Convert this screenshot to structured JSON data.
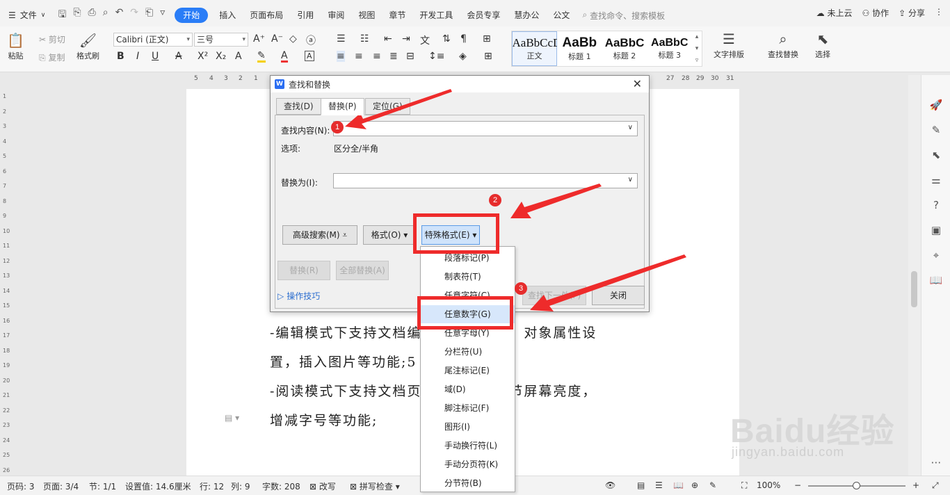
{
  "menubar": {
    "file_label": "文件",
    "tabs": [
      "开始",
      "插入",
      "页面布局",
      "引用",
      "审阅",
      "视图",
      "章节",
      "开发工具",
      "会员专享",
      "慧办公",
      "公文"
    ],
    "search_placeholder": "查找命令、搜索模板",
    "cloud": "未上云",
    "collab": "协作",
    "share": "分享"
  },
  "ribbon": {
    "paste": "粘贴",
    "cut": "剪切",
    "copy": "复制",
    "format_painter": "格式刷",
    "font_name": "Calibri (正文)",
    "font_size": "三号",
    "styles": [
      {
        "sample": "AaBbCcDd",
        "label": "正文"
      },
      {
        "sample": "AaBb",
        "label": "标题 1"
      },
      {
        "sample": "AaBbC",
        "label": "标题 2"
      },
      {
        "sample": "AaBbC",
        "label": "标题 3"
      }
    ],
    "text_layout": "文字排版",
    "find_replace": "查找替换",
    "select": "选择"
  },
  "ruler": {
    "left_ticks": [
      "5",
      "4",
      "3",
      "2",
      "1"
    ],
    "right_ticks": [
      "27",
      "28",
      "29",
      "30",
      "31"
    ],
    "v_ticks": [
      "1",
      "2",
      "3",
      "4",
      "5",
      "6",
      "7",
      "8",
      "9",
      "10",
      "11",
      "12",
      "13",
      "14",
      "15",
      "16",
      "17",
      "18",
      "19",
      "20",
      "21",
      "22",
      "23",
      "24",
      "25",
      "26"
    ]
  },
  "document": {
    "lines": [
      "-编辑模式下支持文档编　　　　　落、对象属性设",
      "置，插入图片等功能;5",
      "-阅读模式下支持文档页　　　　　调节屏幕亮度，",
      "增减字号等功能;"
    ]
  },
  "dialog": {
    "title": "查找和替换",
    "tabs": [
      "查找(D)",
      "替换(P)",
      "定位(G)"
    ],
    "find_label": "查找内容(N):",
    "options_label": "选项:",
    "options_value": "区分全/半角",
    "replace_label": "替换为(I):",
    "advanced_btn": "高级搜索(M)",
    "format_btn": "格式(O)",
    "special_btn": "特殊格式(E)",
    "replace_btn": "替换(R)",
    "replace_all_btn": "全部替换(A)",
    "find_next_btn": "查找下一处(F)",
    "close_btn": "关闭",
    "tips": "操作技巧"
  },
  "dropdown": {
    "items": [
      "段落标记(P)",
      "制表符(T)",
      "任意字符(C)",
      "任意数字(G)",
      "任意字母(Y)",
      "分栏符(U)",
      "尾注标记(E)",
      "域(D)",
      "脚注标记(F)",
      "图形(I)",
      "手动换行符(L)",
      "手动分页符(K)",
      "分节符(B)"
    ],
    "highlighted": "任意数字(G)"
  },
  "annotations": {
    "badges": [
      "1",
      "2",
      "3"
    ],
    "color": "#ee2b2b"
  },
  "status": {
    "page_num": "页码: 3",
    "pages": "页面: 3/4",
    "section": "节: 1/1",
    "setting": "设置值: 14.6厘米",
    "row": "行: 12",
    "col": "列: 9",
    "words": "字数: 208",
    "revise": "改写",
    "spell": "拼写检查",
    "zoom": "100%"
  },
  "watermark": {
    "brand": "Baidu经验",
    "url": "jingyan.baidu.com"
  },
  "colors": {
    "accent": "#2a7df7",
    "annotation": "#ee2b2b",
    "highlight": "#d7e7fb"
  }
}
